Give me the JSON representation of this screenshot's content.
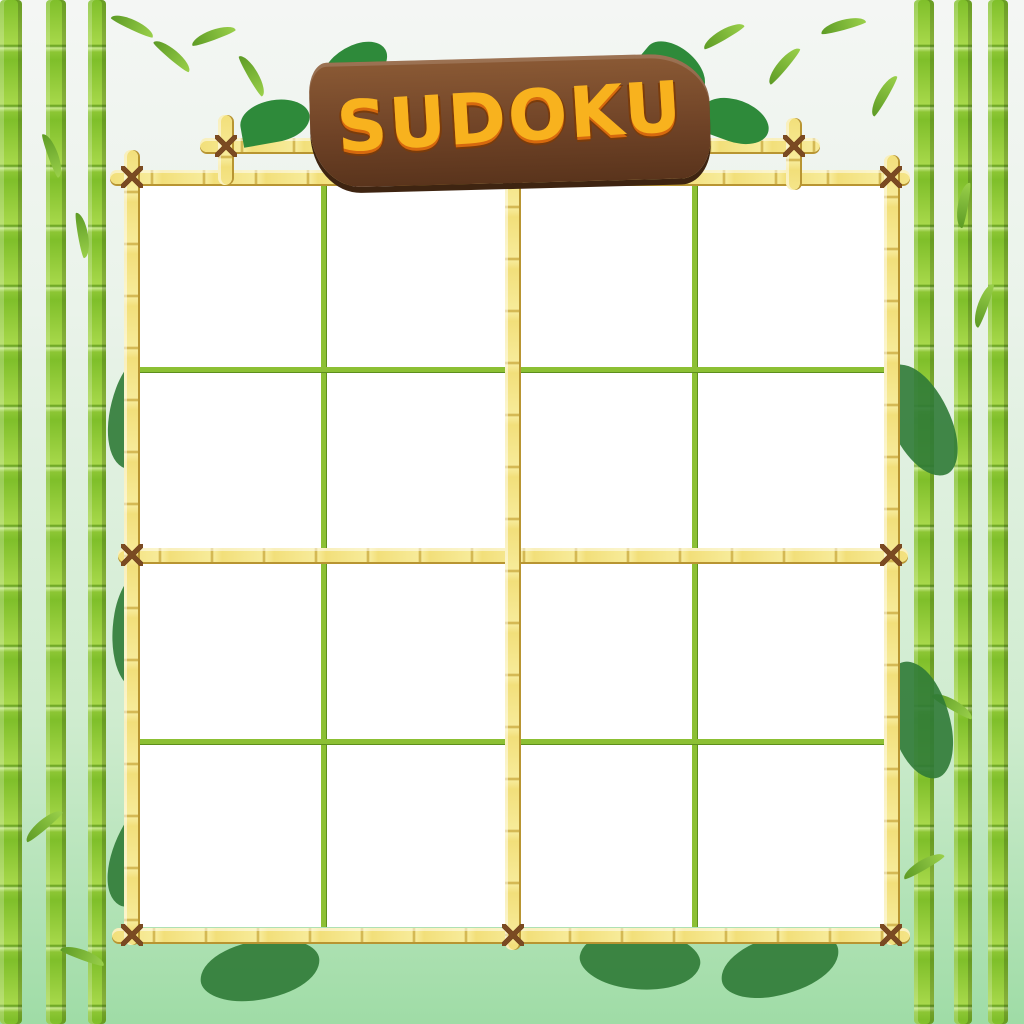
{
  "title": "SUDOKU",
  "grid": {
    "rows": 4,
    "cols": 4,
    "cells": [
      [
        "",
        "",
        "",
        ""
      ],
      [
        "",
        "",
        "",
        ""
      ],
      [
        "",
        "",
        "",
        ""
      ],
      [
        "",
        "",
        "",
        ""
      ]
    ]
  },
  "colors": {
    "bamboo_green": "#8cc034",
    "frame_yellow": "#f2df7a",
    "sign_brown": "#6e4226",
    "title_orange": "#f8b21e"
  },
  "decor": {
    "sign_icon": "wooden-sign",
    "leaf_icon": "bamboo-leaf"
  }
}
